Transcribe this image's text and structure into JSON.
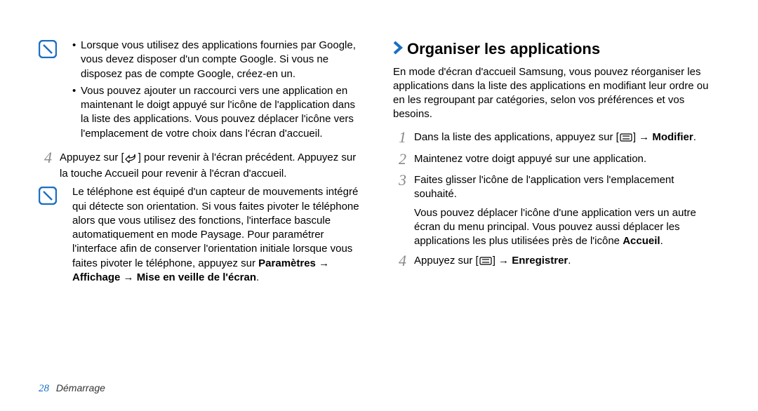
{
  "left": {
    "note1": {
      "b1": "Lorsque vous utilisez des applications fournies par Google, vous devez disposer d'un compte Google. Si vous ne disposez pas de compte Google, créez-en un.",
      "b2": "Vous pouvez ajouter un raccourci vers une application en maintenant le doigt appuyé sur l'icône de l'application dans la liste des applications. Vous pouvez déplacer l'icône vers l'emplacement de votre choix dans l'écran d'accueil."
    },
    "step4": {
      "num": "4",
      "pre": "Appuyez sur [",
      "post": "] pour revenir à l'écran précédent. Appuyez sur la touche Accueil pour revenir à l'écran d'accueil."
    },
    "note2": {
      "pre": "Le téléphone est équipé d'un capteur de mouvements intégré qui détecte son orientation. Si vous faites pivoter le téléphone alors que vous utilisez des fonctions, l'interface bascule automatiquement en mode Paysage. Pour paramétrer l'interface afin de conserver l'orientation initiale lorsque vous faites pivoter le téléphone, appuyez sur ",
      "bold1": "Paramètres",
      "arrow": " → ",
      "bold2": "Affichage",
      "bold3": "Mise en veille de l'écran",
      "dot": "."
    }
  },
  "right": {
    "heading": "Organiser les applications",
    "intro": "En mode d'écran d'accueil Samsung, vous pouvez réorganiser les applications dans la liste des applications en modifiant leur ordre ou en les regroupant par catégories, selon vos préférences et vos besoins.",
    "step1": {
      "num": "1",
      "pre": "Dans la liste des applications, appuyez sur [",
      "post": "] → ",
      "bold": "Modifier",
      "dot": "."
    },
    "step2": {
      "num": "2",
      "text": "Maintenez votre doigt appuyé sur une application."
    },
    "step3": {
      "num": "3",
      "text": "Faites glisser l'icône de l'application vers l'emplacement souhaité.",
      "sub_pre": "Vous pouvez déplacer l'icône d'une application vers un autre écran du menu principal. Vous pouvez aussi déplacer les applications les plus utilisées près de l'icône ",
      "sub_bold": "Accueil",
      "sub_dot": "."
    },
    "step4": {
      "num": "4",
      "pre": "Appuyez sur [",
      "post": "] → ",
      "bold": "Enregistrer",
      "dot": "."
    }
  },
  "footer": {
    "page": "28",
    "section": "Démarrage"
  }
}
